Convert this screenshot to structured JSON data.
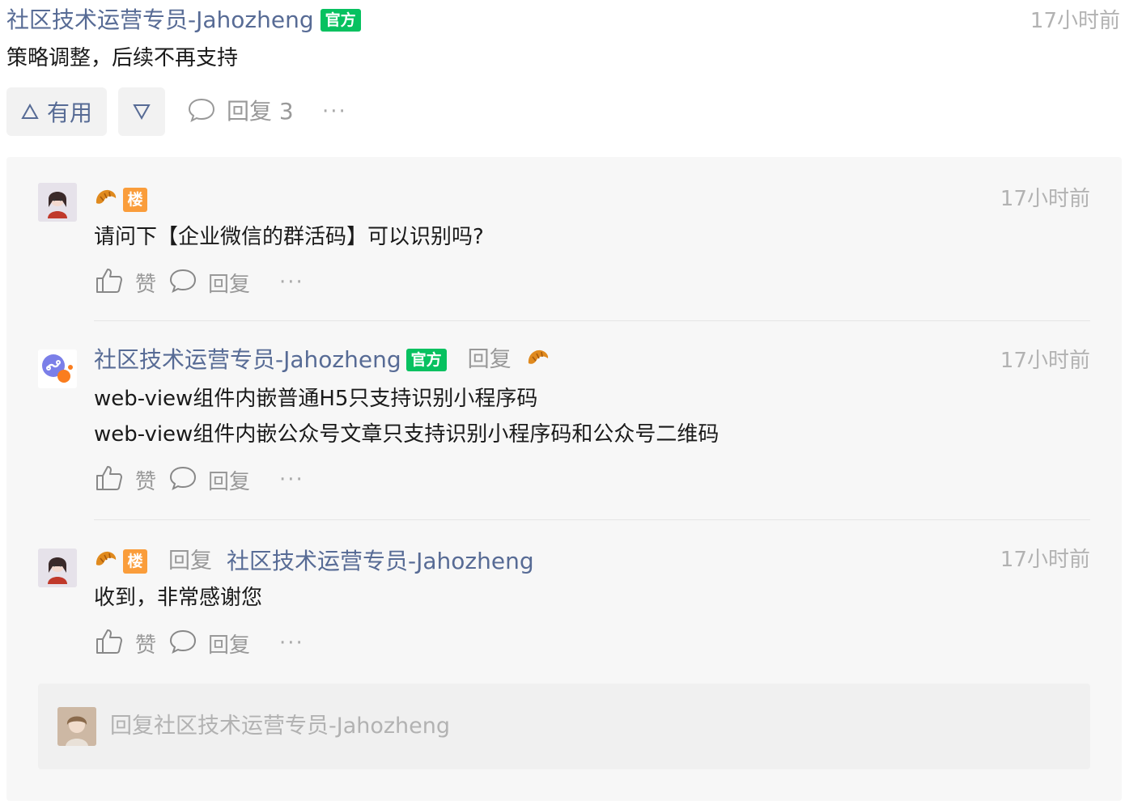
{
  "top_comment": {
    "author": "社区技术运营专员-Jahozheng",
    "badge": "官方",
    "time": "17小时前",
    "content": "策略调整，后续不再支持",
    "useful_label": "有用",
    "reply_label": "回复 3",
    "more": "···"
  },
  "replies": [
    {
      "floor_badge": "楼",
      "time": "17小时前",
      "content": "请问下【企业微信的群活码】可以识别吗?",
      "like_label": "赞",
      "reply_label": "回复",
      "more": "···"
    },
    {
      "author": "社区技术运营专员-Jahozheng",
      "badge": "官方",
      "reply_word": "回复",
      "time": "17小时前",
      "content_lines": [
        "web-view组件内嵌普通H5只支持识别小程序码",
        "web-view组件内嵌公众号文章只支持识别小程序码和公众号二维码"
      ],
      "like_label": "赞",
      "reply_label": "回复",
      "more": "···"
    },
    {
      "floor_badge": "楼",
      "reply_word": "回复",
      "reply_to": "社区技术运营专员-Jahozheng",
      "time": "17小时前",
      "content": "收到，非常感谢您",
      "like_label": "赞",
      "reply_label": "回复",
      "more": "···"
    }
  ],
  "reply_input": {
    "placeholder": "回复社区技术运营专员-Jahozheng"
  },
  "colors": {
    "link": "#576b95",
    "official_green": "#07c160",
    "floor_orange": "#fa9d3b",
    "muted": "#999999"
  }
}
